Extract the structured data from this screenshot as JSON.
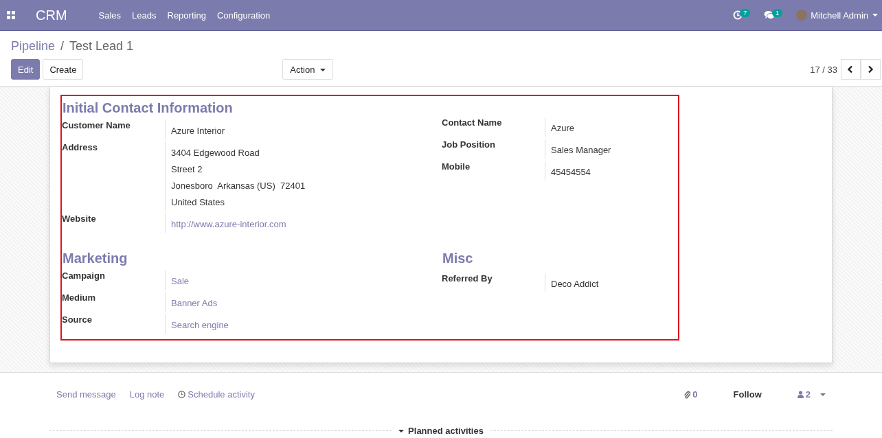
{
  "navbar": {
    "brand": "CRM",
    "menu": [
      "Sales",
      "Leads",
      "Reporting",
      "Configuration"
    ],
    "activity_count": "7",
    "message_count": "1",
    "user": "Mitchell Admin"
  },
  "breadcrumb": {
    "parent": "Pipeline",
    "separator": "/",
    "current": "Test Lead 1"
  },
  "buttons": [
    {
      "label": "Edit",
      "kind": "primary"
    },
    {
      "label": "Create",
      "kind": "secondary"
    }
  ],
  "action": "Action",
  "pager": "17 / 33",
  "sections": [
    {
      "left": {
        "title": "Initial Contact Information",
        "fields": [
          {
            "label": "Customer Name",
            "kind": "text",
            "values": [
              "Azure Interior"
            ]
          },
          {
            "label": "Address",
            "kind": "text",
            "values": [
              "3404 Edgewood Road",
              "Street 2",
              "Jonesboro  Arkansas (US)  72401",
              "United States"
            ]
          },
          {
            "label": "Website",
            "kind": "link",
            "values": [
              "http://www.azure-interior.com"
            ]
          }
        ]
      },
      "right": {
        "fields": [
          {
            "label": "Contact Name",
            "kind": "text",
            "values": [
              "Azure"
            ]
          },
          {
            "label": "Job Position",
            "kind": "text",
            "values": [
              "Sales Manager"
            ]
          },
          {
            "label": "Mobile",
            "kind": "text",
            "values": [
              "45454554"
            ]
          }
        ]
      }
    },
    {
      "left": {
        "title": "Marketing",
        "fields": [
          {
            "label": "Campaign",
            "kind": "link",
            "values": [
              "Sale"
            ]
          },
          {
            "label": "Medium",
            "kind": "link",
            "values": [
              "Banner Ads"
            ]
          },
          {
            "label": "Source",
            "kind": "link",
            "values": [
              "Search engine"
            ]
          }
        ]
      },
      "right": {
        "title": "Misc",
        "fields": [
          {
            "label": "Referred By",
            "kind": "text",
            "values": [
              "Deco Addict"
            ]
          }
        ]
      }
    }
  ],
  "chatter": {
    "actions": [
      {
        "label": "Send message",
        "kind": "message"
      },
      {
        "label": "Log note",
        "kind": "note"
      },
      {
        "label": "Schedule activity",
        "kind": "activity"
      }
    ],
    "attachments": "0",
    "follow": "Follow",
    "followers": "2",
    "planned": "Planned activities"
  }
}
